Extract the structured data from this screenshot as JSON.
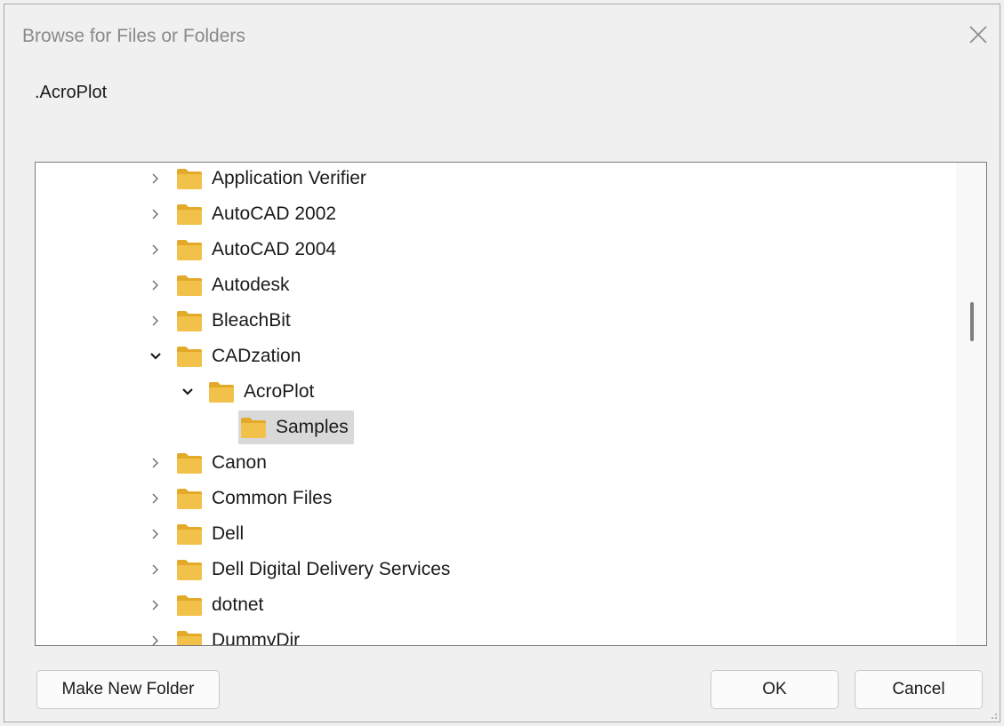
{
  "window": {
    "title": "Browse for Files or Folders",
    "close_icon": "close-icon"
  },
  "subtitle": ".AcroPlot",
  "tree": {
    "items": [
      {
        "label": "Application Verifier",
        "level": 0,
        "expanded": false,
        "selected": false
      },
      {
        "label": "AutoCAD 2002",
        "level": 0,
        "expanded": false,
        "selected": false
      },
      {
        "label": "AutoCAD 2004",
        "level": 0,
        "expanded": false,
        "selected": false
      },
      {
        "label": "Autodesk",
        "level": 0,
        "expanded": false,
        "selected": false
      },
      {
        "label": "BleachBit",
        "level": 0,
        "expanded": false,
        "selected": false
      },
      {
        "label": "CADzation",
        "level": 0,
        "expanded": true,
        "selected": false
      },
      {
        "label": "AcroPlot",
        "level": 1,
        "expanded": true,
        "selected": false
      },
      {
        "label": "Samples",
        "level": 2,
        "expanded": null,
        "selected": true
      },
      {
        "label": "Canon",
        "level": 0,
        "expanded": false,
        "selected": false
      },
      {
        "label": "Common Files",
        "level": 0,
        "expanded": false,
        "selected": false
      },
      {
        "label": "Dell",
        "level": 0,
        "expanded": false,
        "selected": false
      },
      {
        "label": "Dell Digital Delivery Services",
        "level": 0,
        "expanded": false,
        "selected": false
      },
      {
        "label": "dotnet",
        "level": 0,
        "expanded": false,
        "selected": false
      },
      {
        "label": "DummyDir",
        "level": 0,
        "expanded": false,
        "selected": false
      }
    ]
  },
  "buttons": {
    "make_new_folder": "Make New Folder",
    "ok": "OK",
    "cancel": "Cancel"
  },
  "colors": {
    "folder": "#f2c14a",
    "folder_dark": "#e3a928",
    "selected_bg": "#d9d9d9",
    "dialog_bg": "#f0f0f0"
  }
}
